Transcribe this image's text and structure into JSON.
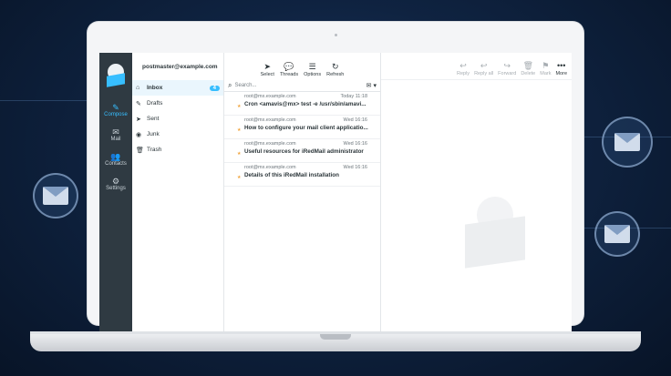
{
  "nav": {
    "items": [
      {
        "label": "Compose",
        "icon": "compose-icon",
        "glyph": "✎"
      },
      {
        "label": "Mail",
        "icon": "mail-icon",
        "glyph": "✉"
      },
      {
        "label": "Contacts",
        "icon": "contacts-icon",
        "glyph": "👥"
      },
      {
        "label": "Settings",
        "icon": "gear-icon",
        "glyph": "⚙"
      }
    ]
  },
  "account": {
    "email": "postmaster@example.com"
  },
  "folders": [
    {
      "label": "Inbox",
      "icon": "inbox-icon",
      "glyph": "⌂",
      "unread": "4"
    },
    {
      "label": "Drafts",
      "icon": "pencil-icon",
      "glyph": "✎"
    },
    {
      "label": "Sent",
      "icon": "send-icon",
      "glyph": "➤"
    },
    {
      "label": "Junk",
      "icon": "junk-icon",
      "glyph": "◉"
    },
    {
      "label": "Trash",
      "icon": "trash-icon",
      "glyph": "🗑"
    }
  ],
  "list_toolbar": [
    {
      "label": "Select",
      "glyph": "➤"
    },
    {
      "label": "Threads",
      "glyph": "💬"
    },
    {
      "label": "Options",
      "glyph": "☰"
    },
    {
      "label": "Refresh",
      "glyph": "↻"
    }
  ],
  "search": {
    "placeholder": "Search..."
  },
  "messages": [
    {
      "from": "root@mx.example.com",
      "date": "Today 11:18",
      "subject": "Cron <amavis@mx> test -e /usr/sbin/amavi..."
    },
    {
      "from": "root@mx.example.com",
      "date": "Wed 16:16",
      "subject": "How to configure your mail client applicatio..."
    },
    {
      "from": "root@mx.example.com",
      "date": "Wed 16:16",
      "subject": "Useful resources for iRedMail administrator"
    },
    {
      "from": "root@mx.example.com",
      "date": "Wed 16:16",
      "subject": "Details of this iRedMail installation"
    }
  ],
  "preview_toolbar": [
    {
      "label": "Reply",
      "glyph": "↩"
    },
    {
      "label": "Reply all",
      "glyph": "↩"
    },
    {
      "label": "Forward",
      "glyph": "↪"
    },
    {
      "label": "Delete",
      "glyph": "🗑"
    },
    {
      "label": "Mark",
      "glyph": "⚑"
    },
    {
      "label": "More",
      "glyph": "•••"
    }
  ],
  "colors": {
    "accent": "#37beff",
    "nav_bg": "#2f3a42",
    "flag": "#f0a33a"
  }
}
